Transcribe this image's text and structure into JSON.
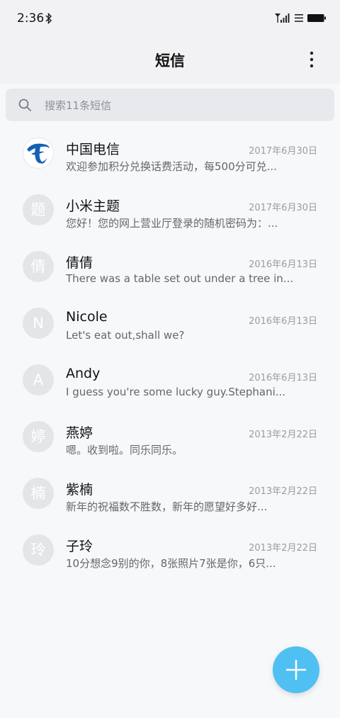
{
  "status_bar": {
    "time": "2:36"
  },
  "header": {
    "title": "短信"
  },
  "search": {
    "placeholder": "搜索11条短信"
  },
  "threads": [
    {
      "name": "中国电信",
      "avatar": "",
      "date": "2017年6月30日",
      "snippet": "欢迎参加积分兑换话费活动，每500分可兑..."
    },
    {
      "name": "小米主题",
      "avatar": "题",
      "date": "2017年6月30日",
      "snippet": "您好！您的网上营业厅登录的随机密码为：..."
    },
    {
      "name": "倩倩",
      "avatar": "倩",
      "date": "2016年6月13日",
      "snippet": "There was a table set out under a tree in..."
    },
    {
      "name": "Nicole",
      "avatar": "N",
      "date": "2016年6月13日",
      "snippet": "Let's eat out,shall we?"
    },
    {
      "name": "Andy",
      "avatar": "A",
      "date": "2016年6月13日",
      "snippet": "I guess you're some lucky guy.Stephani..."
    },
    {
      "name": "燕婷",
      "avatar": "婷",
      "date": "2013年2月22日",
      "snippet": "嗯。收到啦。同乐同乐。"
    },
    {
      "name": "紫楠",
      "avatar": "楠",
      "date": "2013年2月22日",
      "snippet": "新年的祝福数不胜数，新年的愿望好多好..."
    },
    {
      "name": "子玲",
      "avatar": "玲",
      "date": "2013年2月22日",
      "snippet": "10分想念9别的你，8张照片7张是你，6只..."
    }
  ],
  "colors": {
    "accent": "#4fc0f1",
    "avatar_bg": "#e4e5e8",
    "telecom_blue": "#1560b5"
  },
  "icons": [
    "bluetooth-icon",
    "signal-icon",
    "wifi-menu-icon",
    "battery-icon",
    "more-vertical-icon",
    "search-icon",
    "plus-icon"
  ]
}
